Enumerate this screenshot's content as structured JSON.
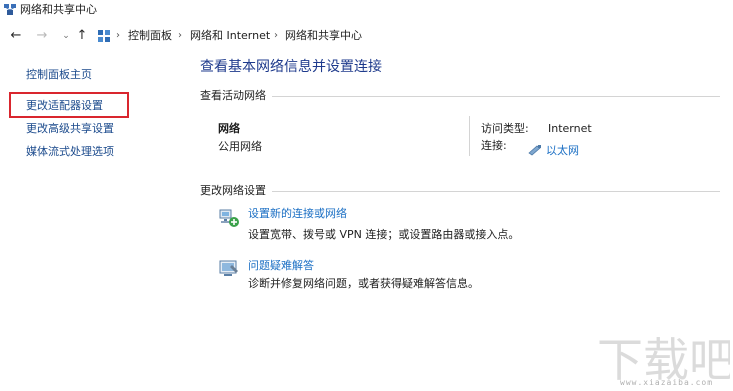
{
  "window": {
    "title": "网络和共享中心",
    "icon": "network-center-icon"
  },
  "address_bar": {
    "nav": {
      "back": "←",
      "forward": "→",
      "recent": "⌄",
      "up": "↑"
    },
    "location_icon": "control-panel-icon",
    "breadcrumbs": [
      "控制面板",
      "网络和 Internet",
      "网络和共享中心"
    ],
    "separator": "›"
  },
  "sidebar": {
    "items": [
      {
        "label": "控制面板主页"
      },
      {
        "label": "更改适配器设置",
        "highlighted": true
      },
      {
        "label": "更改高级共享设置"
      },
      {
        "label": "媒体流式处理选项"
      }
    ],
    "highlight_color": "#d9262e"
  },
  "main": {
    "title": "查看基本网络信息并设置连接",
    "active_networks": {
      "heading": "查看活动网络",
      "network_name": "网络",
      "network_type": "公用网络",
      "access_type_label": "访问类型:",
      "access_type_value": "Internet",
      "connection_label": "连接:",
      "connection_value": "以太网",
      "connection_icon": "ethernet-icon"
    },
    "change_settings": {
      "heading": "更改网络设置",
      "tasks": [
        {
          "icon": "new-connection-icon",
          "link": "设置新的连接或网络",
          "description": "设置宽带、拨号或 VPN 连接；或设置路由器或接入点。"
        },
        {
          "icon": "troubleshoot-icon",
          "link": "问题疑难解答",
          "description": "诊断并修复网络问题，或者获得疑难解答信息。"
        }
      ]
    }
  },
  "colors": {
    "link": "#1b6fc4",
    "title": "#1e3a8c",
    "sidebar_link": "#1b4a8c"
  },
  "watermark": {
    "text": "下载吧",
    "url": "www.xiazaiba.com"
  }
}
